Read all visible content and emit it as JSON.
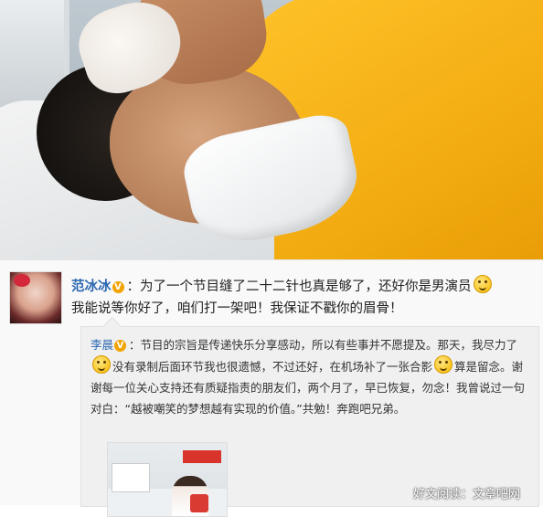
{
  "post": {
    "author": "范冰冰",
    "verified_badge": "V",
    "separator": "：",
    "text_part1": "为了一个节目缝了二十二针也真是够了，还好你是男演员",
    "text_part2": "我能说等你好了，咱们打一架吧！我保证不戳你的眉骨！",
    "emoji_icon": "smile-emoji-icon"
  },
  "repost": {
    "author": "李晨",
    "verified_badge": "V",
    "separator": "：",
    "text_part1": "节目的宗旨是传递快乐分享感动，所以有些事并不愿提及。那天，我尽力了",
    "text_part2": "没有录制后面环节我也很遗憾，不过还好，在机场补了一张合影",
    "text_part3": "算是留念。谢谢每一位关心支持还有质疑指责的朋友们，两个月了，早已恢复，勿念！我曾说过一句对白：“越被嘲笑的梦想越有实现的价值。”共勉！奔跑吧兄弟。"
  },
  "watermark": "好文阅读：文章吧网"
}
